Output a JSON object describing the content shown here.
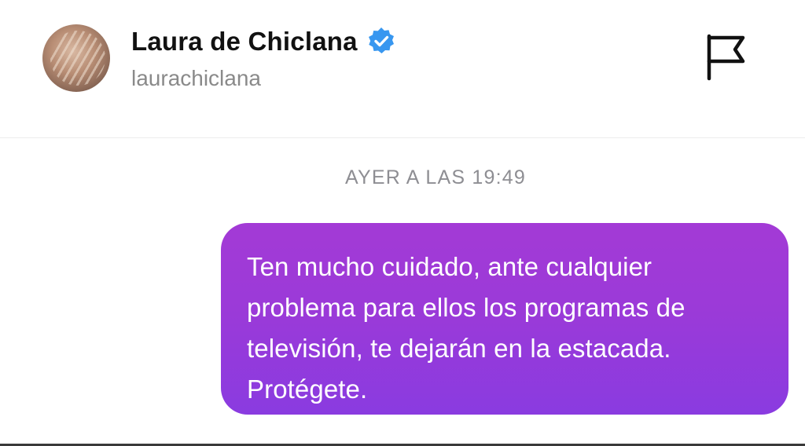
{
  "header": {
    "name": "Laura de Chiclana",
    "handle": "laurachiclana",
    "verified": true,
    "icons": {
      "avatar": "profile-photo",
      "verified": "verified-badge-icon",
      "flag": "flag-icon"
    },
    "colors": {
      "verified": "#3897f0"
    }
  },
  "conversation": {
    "timestamp": "AYER A LAS 19:49",
    "messages": [
      {
        "text": "Ten mucho cuidado, ante cualquier\nproblema para ellos los programas de\ntelevisión, te dejarán en la estacada.\nProtégete.",
        "color": "#9b3ad8"
      }
    ]
  }
}
